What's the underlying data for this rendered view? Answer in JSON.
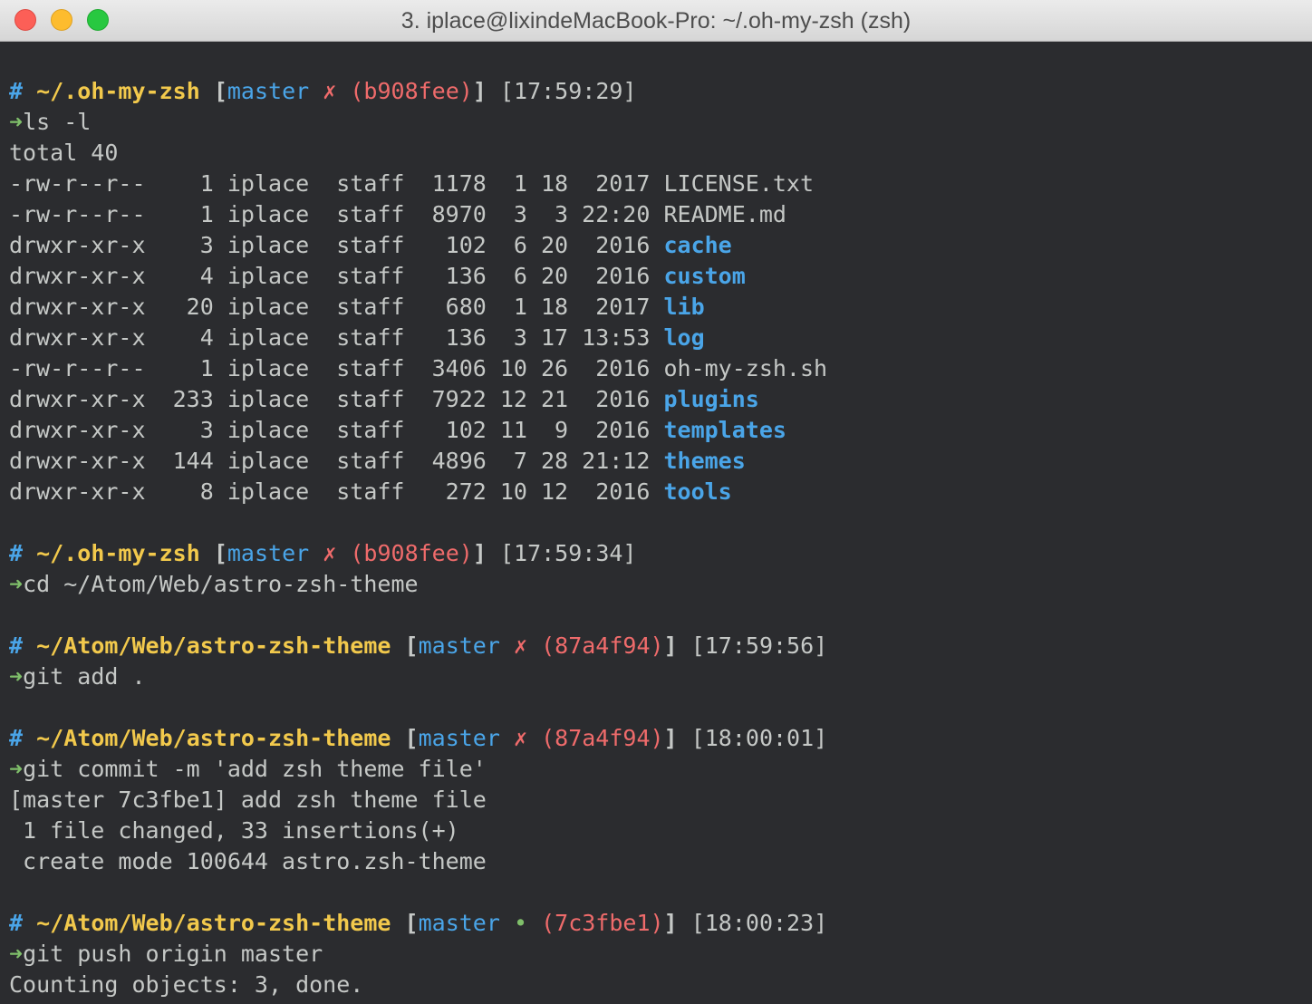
{
  "window": {
    "title": "3. iplace@lixindeMacBook-Pro: ~/.oh-my-zsh (zsh)"
  },
  "colors": {
    "background": "#2b2c2f",
    "prompt_hash": "#4aa5e8",
    "path": "#f2c94c",
    "branch": "#4aa5e8",
    "dirty_mark": "#ef6b6b",
    "clean_mark": "#7fbf6a",
    "arrow": "#7fbf6a",
    "directory": "#4aa5e8"
  },
  "prompts": [
    {
      "hash": "#",
      "path": "~/.oh-my-zsh",
      "open": "[",
      "branch": "master",
      "mark": "✗",
      "commit": "(b908fee)",
      "close": "]",
      "time": "[17:59:29]",
      "arrow": "➜",
      "command": "ls -l"
    },
    {
      "hash": "#",
      "path": "~/.oh-my-zsh",
      "open": "[",
      "branch": "master",
      "mark": "✗",
      "commit": "(b908fee)",
      "close": "]",
      "time": "[17:59:34]",
      "arrow": "➜",
      "command": "cd ~/Atom/Web/astro-zsh-theme"
    },
    {
      "hash": "#",
      "path": "~/Atom/Web/astro-zsh-theme",
      "open": "[",
      "branch": "master",
      "mark": "✗",
      "commit": "(87a4f94)",
      "close": "]",
      "time": "[17:59:56]",
      "arrow": "➜",
      "command": "git add ."
    },
    {
      "hash": "#",
      "path": "~/Atom/Web/astro-zsh-theme",
      "open": "[",
      "branch": "master",
      "mark": "✗",
      "commit": "(87a4f94)",
      "close": "]",
      "time": "[18:00:01]",
      "arrow": "➜",
      "command": "git commit -m 'add zsh theme file'"
    },
    {
      "hash": "#",
      "path": "~/Atom/Web/astro-zsh-theme",
      "open": "[",
      "branch": "master",
      "mark": "•",
      "commit": "(7c3fbe1)",
      "close": "]",
      "time": "[18:00:23]",
      "arrow": "➜",
      "command": "git push origin master"
    }
  ],
  "ls": {
    "total": "total 40",
    "rows": [
      {
        "meta": "-rw-r--r--    1 iplace  staff  1178  1 18  2017 ",
        "name": "LICENSE.txt"
      },
      {
        "meta": "-rw-r--r--    1 iplace  staff  8970  3  3 22:20 ",
        "name": "README.md"
      },
      {
        "meta": "drwxr-xr-x    3 iplace  staff   102  6 20  2016 ",
        "name": "cache"
      },
      {
        "meta": "drwxr-xr-x    4 iplace  staff   136  6 20  2016 ",
        "name": "custom"
      },
      {
        "meta": "drwxr-xr-x   20 iplace  staff   680  1 18  2017 ",
        "name": "lib"
      },
      {
        "meta": "drwxr-xr-x    4 iplace  staff   136  3 17 13:53 ",
        "name": "log"
      },
      {
        "meta": "-rw-r--r--    1 iplace  staff  3406 10 26  2016 ",
        "name": "oh-my-zsh.sh"
      },
      {
        "meta": "drwxr-xr-x  233 iplace  staff  7922 12 21  2016 ",
        "name": "plugins"
      },
      {
        "meta": "drwxr-xr-x    3 iplace  staff   102 11  9  2016 ",
        "name": "templates"
      },
      {
        "meta": "drwxr-xr-x  144 iplace  staff  4896  7 28 21:12 ",
        "name": "themes"
      },
      {
        "meta": "drwxr-xr-x    8 iplace  staff   272 10 12  2016 ",
        "name": "tools"
      }
    ]
  },
  "commit_output": [
    "[master 7c3fbe1] add zsh theme file",
    " 1 file changed, 33 insertions(+)",
    " create mode 100644 astro.zsh-theme"
  ],
  "push_output": [
    "Counting objects: 3, done."
  ]
}
